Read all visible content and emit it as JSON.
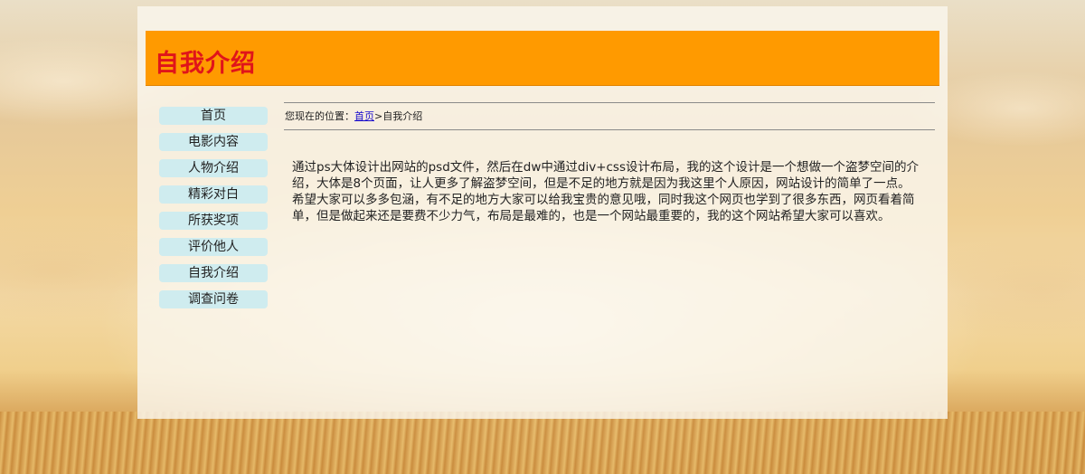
{
  "header": {
    "title": "自我介绍"
  },
  "sidebar": {
    "items": [
      {
        "label": "首页"
      },
      {
        "label": "电影内容"
      },
      {
        "label": "人物介绍"
      },
      {
        "label": "精彩对白"
      },
      {
        "label": "所获奖项"
      },
      {
        "label": "评价他人"
      },
      {
        "label": "自我介绍"
      },
      {
        "label": "调查问卷"
      }
    ]
  },
  "breadcrumb": {
    "prefix": "您现在的位置：",
    "home_link": "首页",
    "separator": ">",
    "current": "自我介绍"
  },
  "article": {
    "paragraphs": [
      "通过ps大体设计出网站的psd文件，然后在dw中通过div+css设计布局，我的这个设计是一个想做一个盗梦空间的介绍，大体是8个页面，让人更多了解盗梦空间，但是不足的地方就是因为我这里个人原因，网站设计的简单了一点。",
      "希望大家可以多多包涵，有不足的地方大家可以给我宝贵的意见哦，同时我这个网页也学到了很多东西，网页看着简单，但是做起来还是要费不少力气，布局是最难的，也是一个网站最重要的，我的这个网站希望大家可以喜欢。"
    ]
  },
  "colors": {
    "header_bg": "#ff9a00",
    "title_text": "#e0141a",
    "nav_bg": "#cfecef",
    "link": "#1a0dcc"
  }
}
